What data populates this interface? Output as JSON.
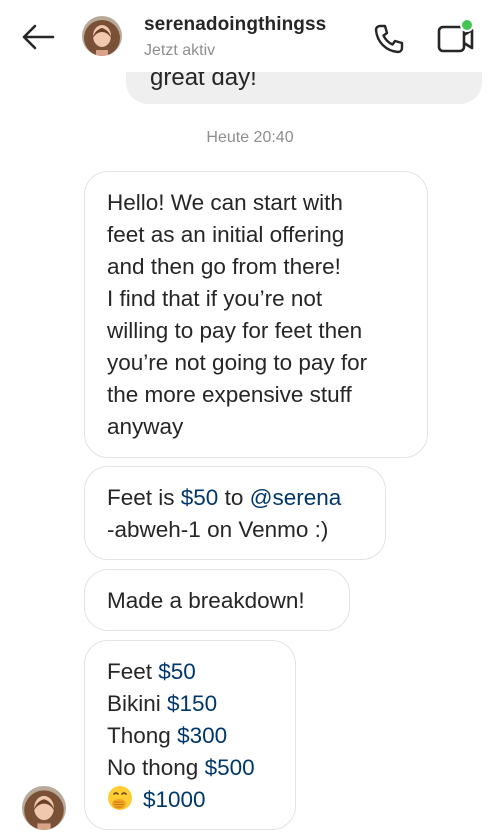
{
  "header": {
    "username": "serenadoingthingss",
    "status": "Jetzt aktiv",
    "icons": {
      "back": "arrow-left-icon",
      "call": "phone-icon",
      "video": "video-camera-icon",
      "avatar": "profile-avatar"
    },
    "online_dot_color": "#44c553"
  },
  "conversation": {
    "previous_message_fragment": "great day!",
    "timestamp": "Heute 20:40",
    "messages": [
      {
        "lines": [
          "Hello! We can start with",
          "feet as an initial offering",
          "and then go from there!",
          "I find that if you’re not",
          "willing to pay for feet then",
          "you’re not going to pay for",
          "the more expensive stuff",
          "anyway"
        ]
      },
      {
        "line1_prefix": "Feet is ",
        "line1_amount": "$50",
        "line1_mid": " to ",
        "line1_handle": "@serena",
        "line2_handle": "-abweh-1",
        "line2_suffix": " on Venmo :)"
      },
      {
        "text": "Made a breakdown!"
      },
      {
        "items": [
          {
            "label": "Feet ",
            "price": "$50"
          },
          {
            "label": "Bikini ",
            "price": "$150"
          },
          {
            "label": "Thong ",
            "price": "$300"
          },
          {
            "label": "No thong ",
            "price": "$500"
          },
          {
            "label": "",
            "price": "$1000",
            "emoji": "hand-over-mouth-emoji"
          }
        ]
      }
    ]
  },
  "colors": {
    "link": "#00376b",
    "muted_text": "#8e8e8e",
    "bubble_border": "#e3e3e3",
    "incoming_prev_bubble": "#efefef"
  }
}
